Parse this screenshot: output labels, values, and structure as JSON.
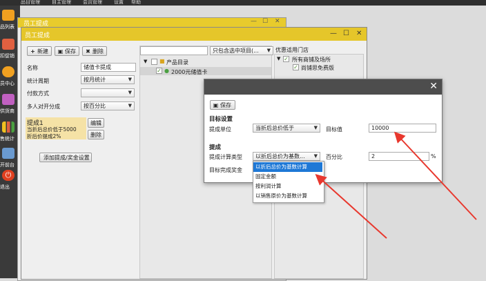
{
  "menubar": {
    "items": [
      "品目管理",
      "自主管理",
      "会员管理",
      "设置",
      "帮助"
    ]
  },
  "sidebar": {
    "items": [
      {
        "label": "品列表",
        "icon": "list-icon",
        "color": "#f0a020"
      },
      {
        "label": "扣促销",
        "icon": "tag-icon",
        "color": "#e06040"
      },
      {
        "label": "员中心",
        "icon": "people-icon",
        "color": "#f0a020"
      },
      {
        "label": "供货商",
        "icon": "supplier-icon",
        "color": "#c060c0"
      },
      {
        "label": "售统计",
        "icon": "chart-icon",
        "color": "#f0c020"
      },
      {
        "label": "开前台",
        "icon": "pos-icon",
        "color": "#6a9ad0"
      },
      {
        "label": "退出",
        "icon": "power-icon",
        "color": "#e04020"
      }
    ]
  },
  "bg_window": {
    "title": "员工提成"
  },
  "main_window": {
    "title": "员工提成",
    "toolbar": {
      "new": "新建",
      "save": "保存",
      "delete": "删除"
    },
    "form": {
      "name_label": "名称",
      "name_value": "储值卡提成",
      "period_label": "统计周期",
      "period_value": "按月统计",
      "payment_label": "付款方式",
      "payment_value": "",
      "split_label": "多人对开分成",
      "split_value": "按百分比"
    },
    "commission": {
      "title": "提成1",
      "line1": "当折后总价低于5000",
      "line2": "折后价提成2%",
      "edit": "编辑",
      "delete": "删除"
    },
    "add_button": "添加提成/奖金设置",
    "filter_value": "只包含选中项目(...",
    "tree": {
      "root": "产品目录",
      "child": "2000元储值卡"
    },
    "store_header": "优惠适用门店",
    "stores": {
      "all": "所有商铺及场所",
      "store1": "尚铺思免费版"
    }
  },
  "dialog": {
    "save": "保存",
    "target_section": "目标设置",
    "unit_label": "提成单位",
    "unit_value": "当折后总价低于",
    "target_label": "目标值",
    "target_value": "10000",
    "commission_section": "提成",
    "calc_label": "提成计算类型",
    "calc_value": "以折后总价为基数...",
    "percent_label": "百分比",
    "percent_value": "2",
    "percent_unit": "%",
    "bonus_label": "目标完成奖金"
  },
  "dropdown": {
    "options": [
      "以折后总价为基数计算",
      "固定金额",
      "按利润计算",
      "以销售原价为基数计算"
    ],
    "selected": "以折后总价为基数计算"
  },
  "colors": {
    "titlebar": "#e5c62a",
    "dialog_header": "#4d4d4d",
    "selected": "#1e78d6",
    "arrow": "#e8382e"
  }
}
